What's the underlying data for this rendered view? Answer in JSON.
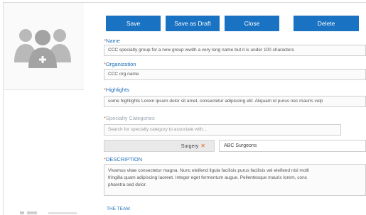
{
  "toolbar": {
    "save": "Save",
    "save_draft": "Save as Draft",
    "close": "Close",
    "delete": "Delete"
  },
  "form": {
    "name": {
      "required_mark": "*",
      "label": "Name",
      "value": "CCC specialty group for a new group wwith a very long name but it is under 100 characters"
    },
    "organization": {
      "required_mark": "*",
      "label": "Organization",
      "value": "CCC org name"
    },
    "highlights": {
      "required_mark": "*",
      "label": "Highlights",
      "value": "some highlights Lorem ipsum dolor sit amet, consectetur adipiscing elit. Aliquam id purus nec mauris vulp"
    },
    "specialty_categories": {
      "required_mark": "*",
      "label": "Specialty Categories",
      "placeholder": "Search for specialty category to associate with...",
      "tag": "Surgery",
      "tag_remove": "✕",
      "tag_value": "ABC Surgeons"
    },
    "description": {
      "required_mark": "*",
      "label": "DESCRIPTION",
      "lines": [
        "Vivamus vitae consectetur magna. Nunc eleifend ligula facilisis purus facilisis vel eleifend nisl molli",
        "fringilla quam adipiscing laoreet. Integer eget fermentum augue. Pellentesque mauris lorem, cons",
        "pharetra sed dolor."
      ]
    },
    "team": {
      "label": "THE TEAM"
    }
  },
  "colors": {
    "button": "#1a72c2",
    "label": "#1e6fb8",
    "required": "#e8602a"
  },
  "icons": {
    "avatar": "group-users-icon"
  }
}
